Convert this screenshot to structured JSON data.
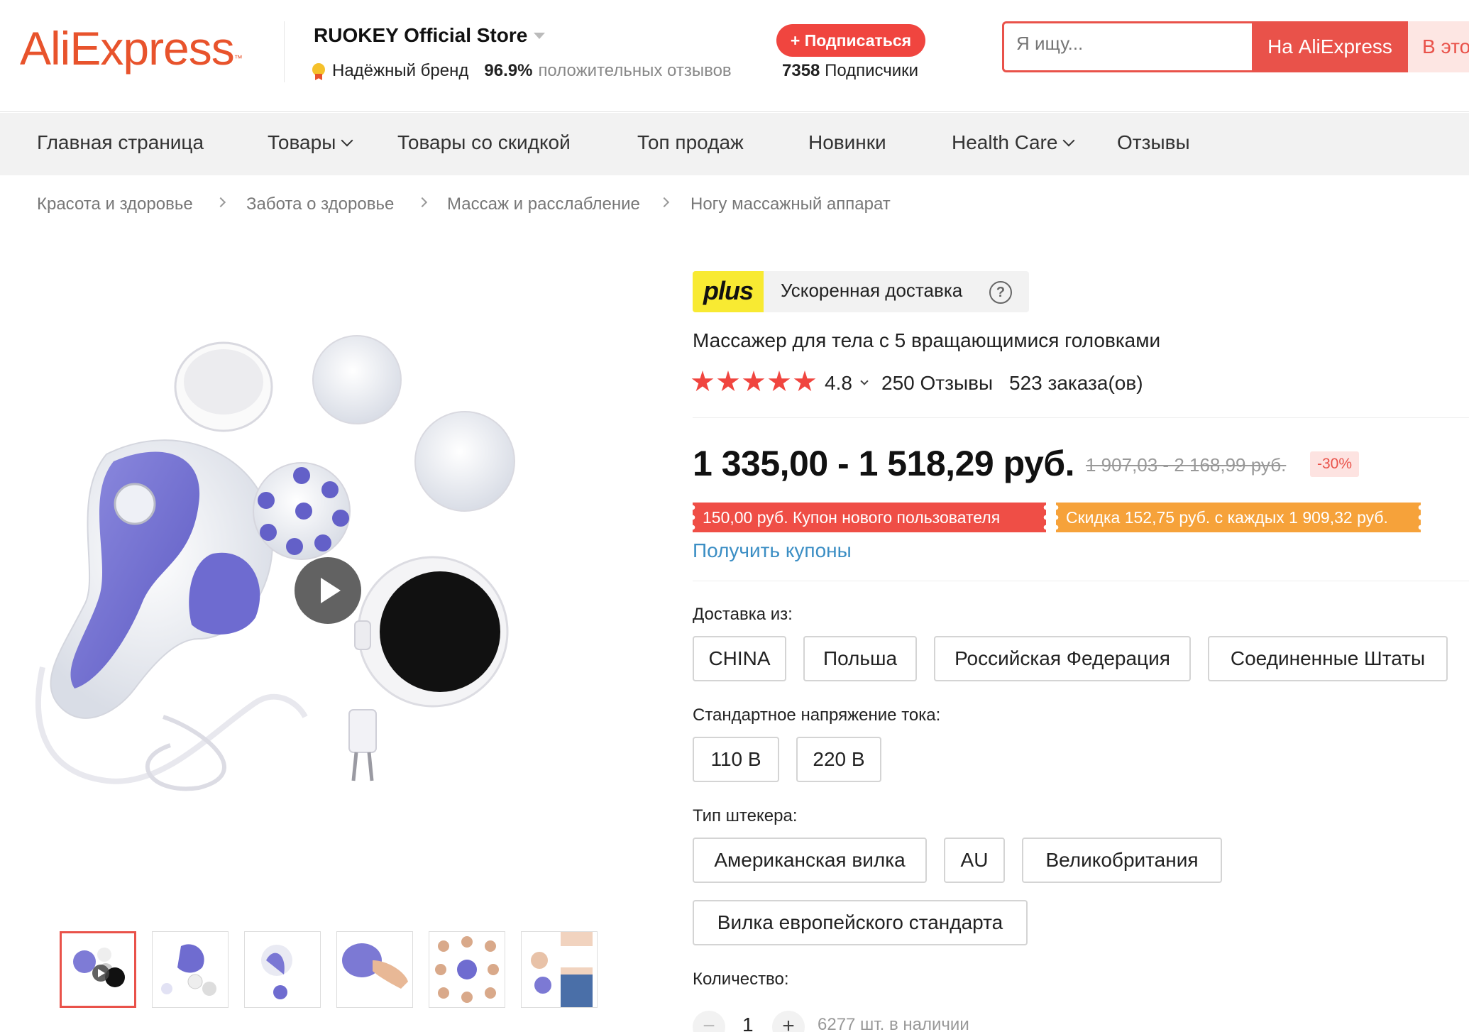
{
  "header": {
    "logo": "AliExpress",
    "logo_tm": "™",
    "store_name": "RUOKEY Official Store",
    "brand_label": "Надёжный бренд",
    "positive_percent": "96.9%",
    "positive_label": "положительных отзывов",
    "subscribe_label": "+ Подписаться",
    "followers_count": "7358",
    "followers_label": "Подписчики",
    "search_placeholder": "Я ищу...",
    "search_all_label": "На AliExpress",
    "search_store_label": "В этом магазине"
  },
  "nav": {
    "items": [
      {
        "label": "Главная страница"
      },
      {
        "label": "Товары"
      },
      {
        "label": "Товары со скидкой"
      },
      {
        "label": "Топ продаж"
      },
      {
        "label": "Новинки"
      },
      {
        "label": "Health Care"
      },
      {
        "label": "Отзывы"
      }
    ]
  },
  "breadcrumb": [
    "Красота и здоровье",
    "Забота о здоровье",
    "Массаж и расслабление",
    "Ногу массажный аппарат"
  ],
  "product": {
    "plus_logo": "plus",
    "plus_text": "Ускоренная доставка",
    "help": "?",
    "title": "Массажер для тела с 5 вращающимися головками",
    "rating": "4.8",
    "stars": 5,
    "reviews": "250 Отзывы",
    "orders": "523 заказа(ов)",
    "price": "1 335,00 - 1 518,29 руб.",
    "old_price": "1 907,03 - 2 168,99 руб.",
    "discount": "-30%",
    "coupon_new_user": "150,00 руб. Купон нового пользователя",
    "coupon_discount": "Скидка 152,75 руб. с каждых 1 909,32 руб.",
    "get_coupons": "Получить купоны"
  },
  "options": {
    "ship_from_label": "Доставка из:",
    "ship_from": [
      "CHINA",
      "Польша",
      "Российская Федерация",
      "Соединенные Штаты"
    ],
    "voltage_label": "Стандартное напряжение тока:",
    "voltage": [
      "110 В",
      "220 В"
    ],
    "plug_label": "Тип штекера:",
    "plug": [
      "Американская вилка",
      "AU",
      "Великобритания",
      "Вилка европейского стандарта"
    ],
    "quantity_label": "Количество:",
    "quantity": "1",
    "minus": "−",
    "plus": "+",
    "stock": "6277 шт. в наличии"
  },
  "colors": {
    "accent": "#e9524a",
    "link": "#3b8ec4",
    "star": "#f0453f",
    "plus_yellow": "#f8ea32",
    "coupon_orange": "#f6a23a"
  },
  "icons": [
    "medal-icon",
    "chevron-down-icon",
    "help-icon",
    "star-icon",
    "play-icon",
    "chevron-right-icon"
  ]
}
